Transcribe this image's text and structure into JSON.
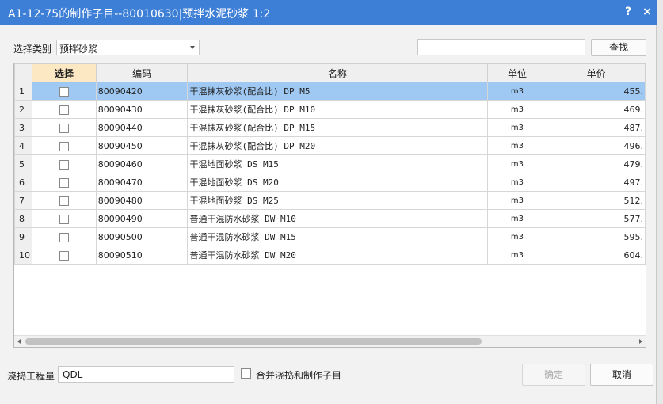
{
  "window": {
    "title": "A1-12-75的制作子目--80010630|预拌水泥砂浆 1:2",
    "help_label": "?",
    "close_label": "×"
  },
  "filter": {
    "category_label": "选择类别",
    "category_value": "预拌砂浆",
    "search_value": "",
    "search_button": "查找"
  },
  "table": {
    "columns": [
      "选择",
      "编码",
      "名称",
      "单位",
      "单价"
    ],
    "rows": [
      {
        "n": "1",
        "code": "80090420",
        "name": "干混抹灰砂浆(配合比) DP M5",
        "unit": "m3",
        "price": "455."
      },
      {
        "n": "2",
        "code": "80090430",
        "name": "干混抹灰砂浆(配合比) DP M10",
        "unit": "m3",
        "price": "469."
      },
      {
        "n": "3",
        "code": "80090440",
        "name": "干混抹灰砂浆(配合比) DP M15",
        "unit": "m3",
        "price": "487."
      },
      {
        "n": "4",
        "code": "80090450",
        "name": "干混抹灰砂浆(配合比) DP M20",
        "unit": "m3",
        "price": "496."
      },
      {
        "n": "5",
        "code": "80090460",
        "name": "干混地面砂浆 DS M15",
        "unit": "m3",
        "price": "479."
      },
      {
        "n": "6",
        "code": "80090470",
        "name": "干混地面砂浆 DS M20",
        "unit": "m3",
        "price": "497."
      },
      {
        "n": "7",
        "code": "80090480",
        "name": "干混地面砂浆 DS M25",
        "unit": "m3",
        "price": "512."
      },
      {
        "n": "8",
        "code": "80090490",
        "name": "普通干混防水砂浆 DW M10",
        "unit": "m3",
        "price": "577."
      },
      {
        "n": "9",
        "code": "80090500",
        "name": "普通干混防水砂浆 DW M15",
        "unit": "m3",
        "price": "595."
      },
      {
        "n": "10",
        "code": "80090510",
        "name": "普通干混防水砂浆 DW M20",
        "unit": "m3",
        "price": "604."
      }
    ],
    "selected_row": 0
  },
  "footer": {
    "quantity_label": "浇捣工程量",
    "quantity_value": "QDL",
    "merge_label": "合并浇捣和制作子目",
    "ok_button": "确定",
    "cancel_button": "取消"
  },
  "colors": {
    "titlebar": "#3d7fd6",
    "selected_row": "#9fc8f2",
    "select_header": "#fce8c2"
  }
}
